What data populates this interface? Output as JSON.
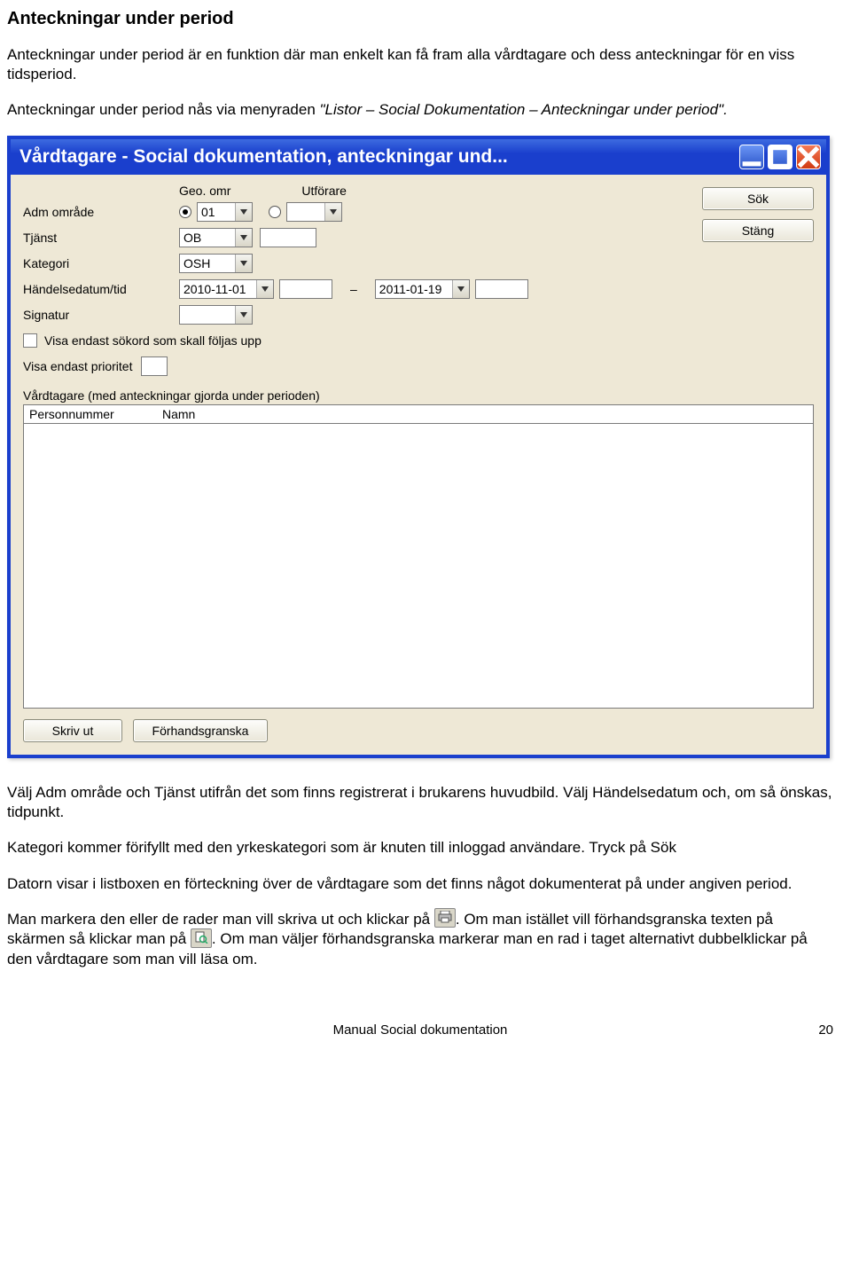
{
  "heading": "Anteckningar under period",
  "intro1": "Anteckningar under period är en funktion där man enkelt kan få fram alla vårdtagare och dess anteckningar för en viss tidsperiod.",
  "intro2_a": "Anteckningar under period nås via menyraden ",
  "intro2_b": "\"Listor – Social Dokumentation – Anteckningar under period\".",
  "window": {
    "title": "Vårdtagare - Social dokumentation, anteckningar und...",
    "header_geo": "Geo. omr",
    "header_utf": "Utförare",
    "labels": {
      "adm": "Adm område",
      "tjanst": "Tjänst",
      "kategori": "Kategori",
      "handelse": "Händelsedatum/tid",
      "signatur": "Signatur",
      "visa_sokord": "Visa endast sökord som skall följas upp",
      "visa_prio": "Visa endast prioritet",
      "vardtagare_header": "Vårdtagare (med anteckningar gjorda under perioden)",
      "col_pnr": "Personnummer",
      "col_namn": "Namn"
    },
    "values": {
      "adm_geo": "01",
      "tjanst": "OB",
      "kategori": "OSH",
      "date_from": "2010-11-01",
      "date_to": "2011-01-19",
      "dash": "–"
    },
    "buttons": {
      "sok": "Sök",
      "stang": "Stäng",
      "skriv_ut": "Skriv ut",
      "forhand": "Förhandsgranska"
    }
  },
  "para2": "Välj Adm område och Tjänst utifrån det som finns registrerat i brukarens huvudbild. Välj Händelsedatum och, om så önskas, tidpunkt.",
  "para3": "Kategori kommer förifyllt med den yrkeskategori som är knuten till inloggad användare. Tryck på Sök",
  "para4": "Datorn visar i listboxen en förteckning över de vårdtagare som det finns något dokumenterat på under angiven period.",
  "para5a": "Man markera den eller de rader man vill skriva ut och klickar på ",
  "para5b": ". Om man istället vill förhandsgranska texten på skärmen så klickar man på ",
  "para5c": ". Om man väljer förhandsgranska markerar man en rad i taget alternativt dubbelklickar på den vårdtagare som man vill läsa om.",
  "footer_center": "Manual Social dokumentation",
  "footer_page": "20"
}
